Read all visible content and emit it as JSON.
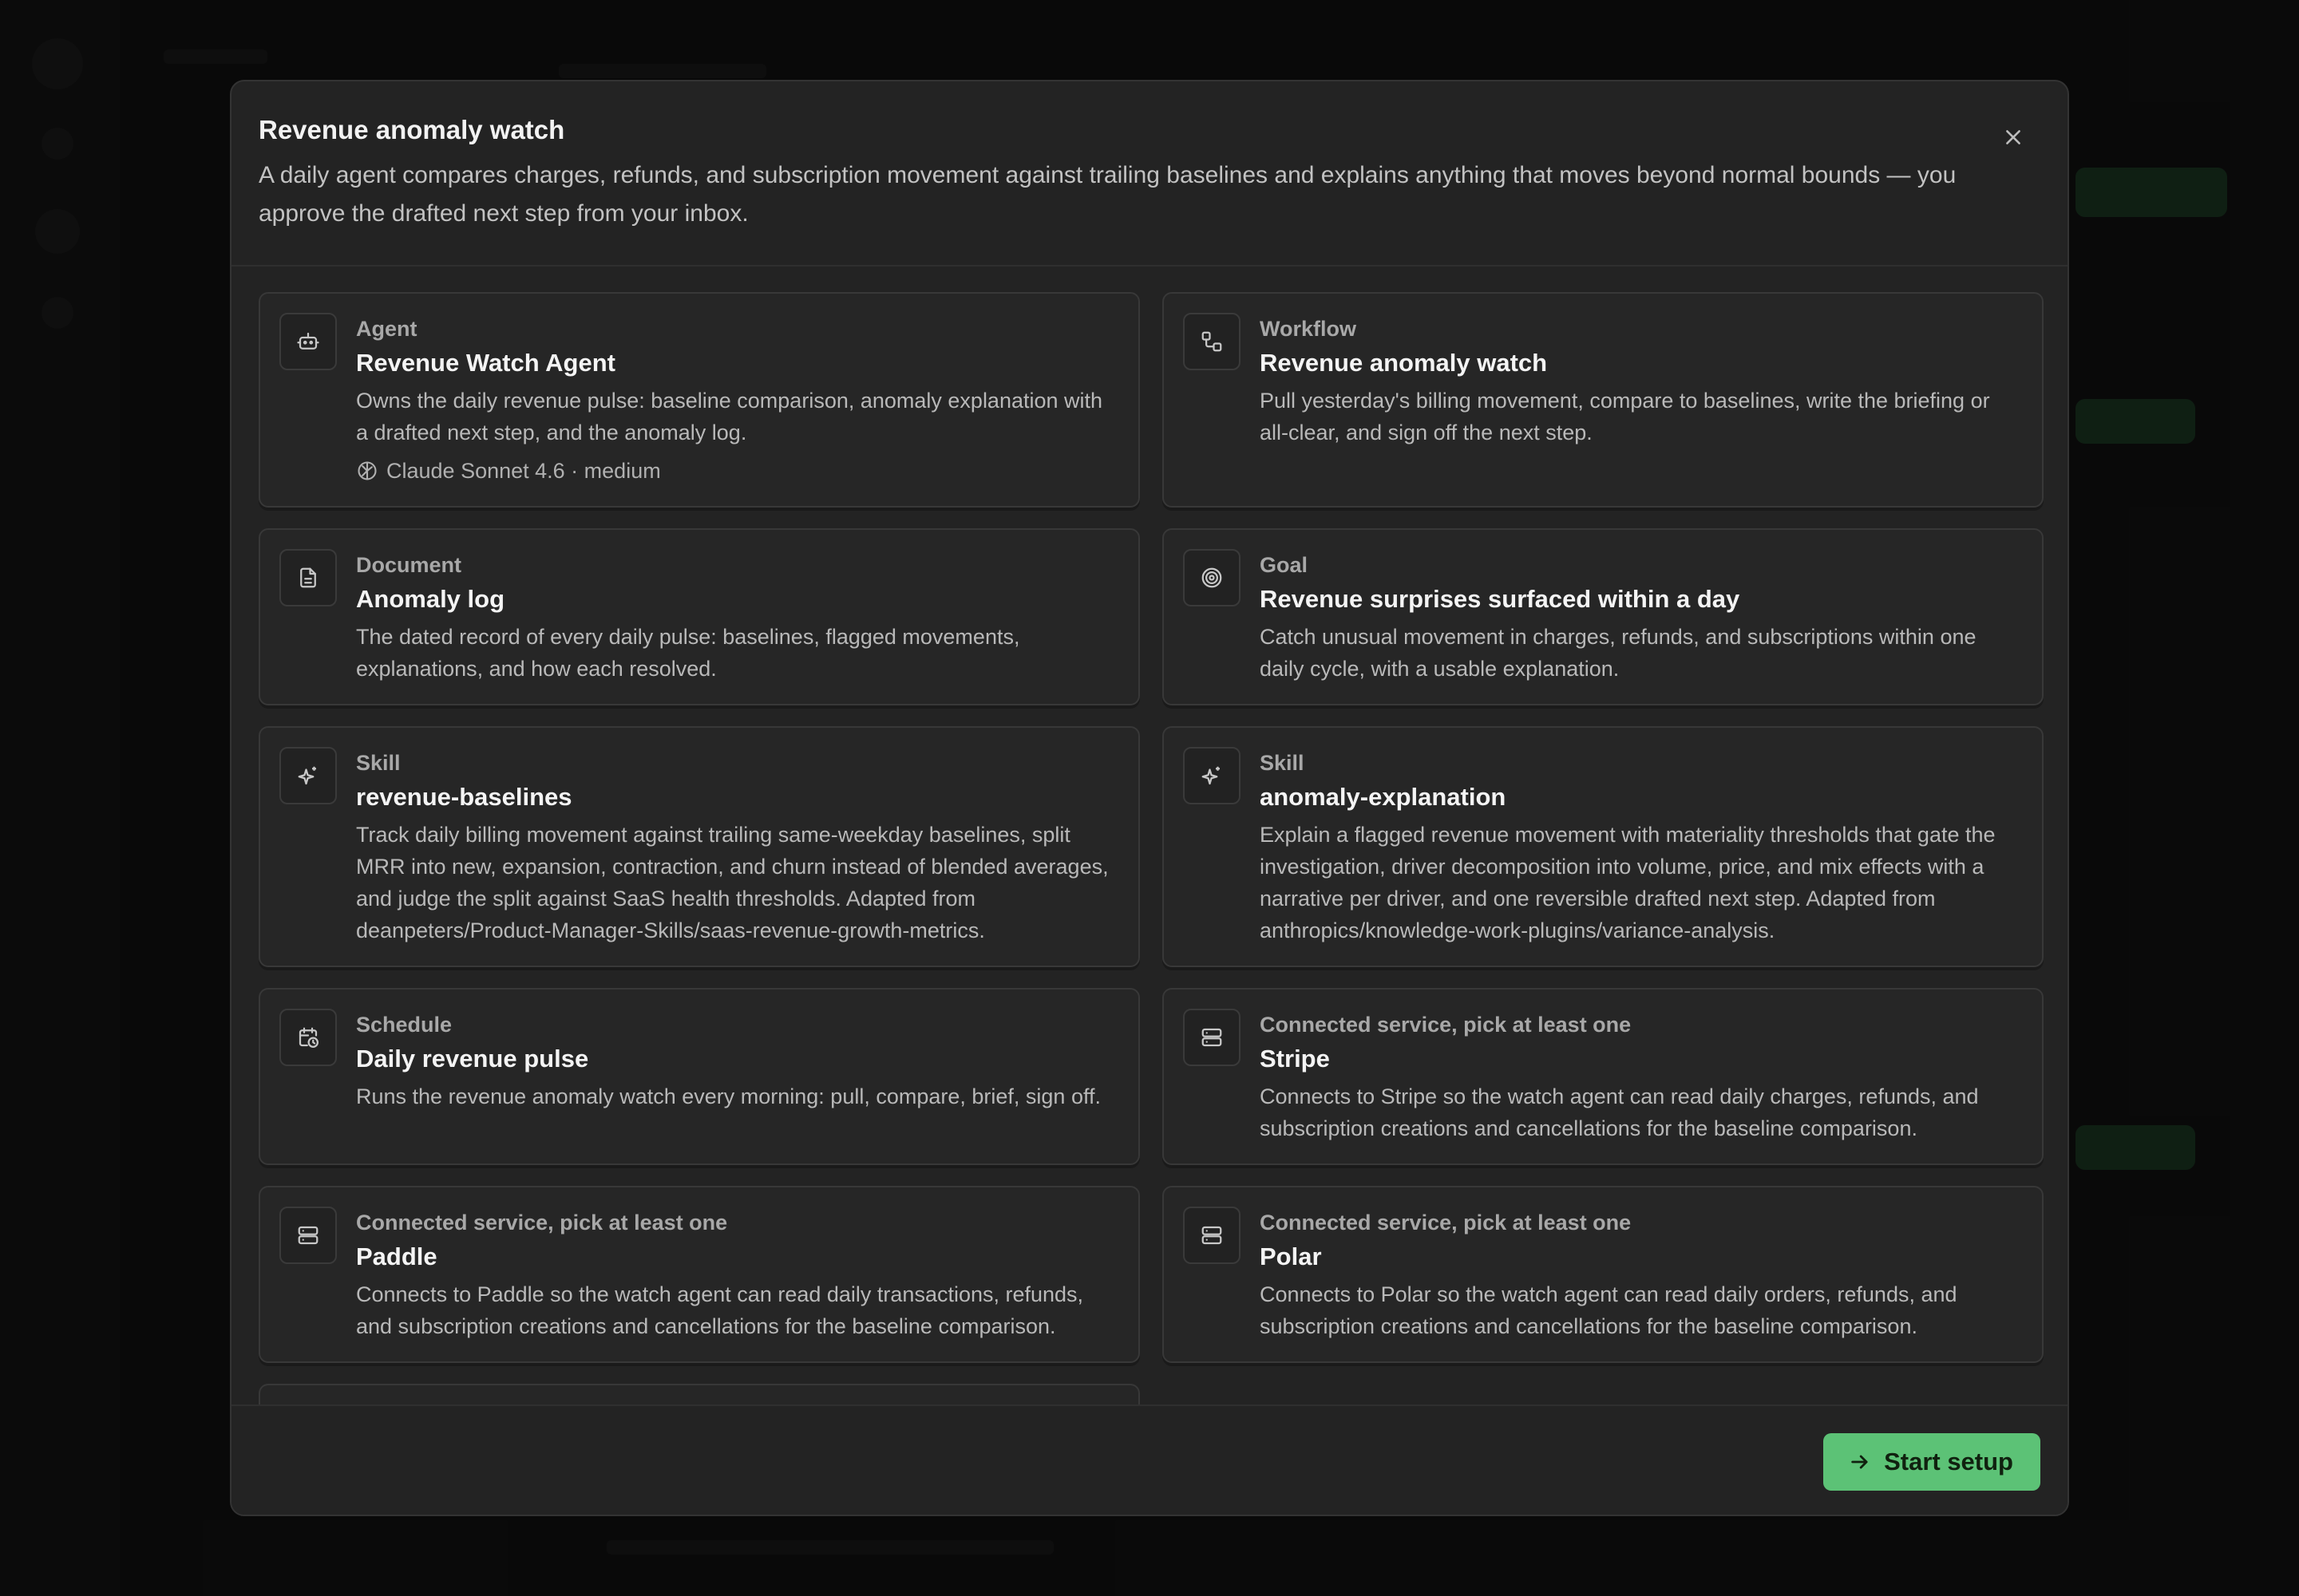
{
  "dialog": {
    "title": "Revenue anomaly watch",
    "description": "A daily agent compares charges, refunds, and subscription movement against trailing baselines and explains anything that moves beyond normal bounds — you approve the drafted next step from your inbox.",
    "close_icon": "close-icon"
  },
  "cards": [
    {
      "type": "Agent",
      "title": "Revenue Watch Agent",
      "description": "Owns the daily revenue pulse: baseline comparison, anomaly explanation with a drafted next step, and the anomaly log.",
      "meta": "Claude Sonnet 4.6 · medium",
      "icon": "robot-icon"
    },
    {
      "type": "Workflow",
      "title": "Revenue anomaly watch",
      "description": "Pull yesterday's billing movement, compare to baselines, write the briefing or all-clear, and sign off the next step.",
      "icon": "workflow-icon"
    },
    {
      "type": "Document",
      "title": "Anomaly log",
      "description": "The dated record of every daily pulse: baselines, flagged movements, explanations, and how each resolved.",
      "icon": "document-icon"
    },
    {
      "type": "Goal",
      "title": "Revenue surprises surfaced within a day",
      "description": "Catch unusual movement in charges, refunds, and subscriptions within one daily cycle, with a usable explanation.",
      "icon": "target-icon"
    },
    {
      "type": "Skill",
      "title": "revenue-baselines",
      "description": "Track daily billing movement against trailing same-weekday baselines, split MRR into new, expansion, contraction, and churn instead of blended averages, and judge the split against SaaS health thresholds. Adapted from deanpeters/Product-Manager-Skills/saas-revenue-growth-metrics.",
      "icon": "sparkle-icon"
    },
    {
      "type": "Skill",
      "title": "anomaly-explanation",
      "description": "Explain a flagged revenue movement with materiality thresholds that gate the investigation, driver decomposition into volume, price, and mix effects with a narrative per driver, and one reversible drafted next step. Adapted from anthropics/knowledge-work-plugins/variance-analysis.",
      "icon": "sparkle-icon"
    },
    {
      "type": "Schedule",
      "title": "Daily revenue pulse",
      "description": "Runs the revenue anomaly watch every morning: pull, compare, brief, sign off.",
      "icon": "calendar-clock-icon"
    },
    {
      "type": "Connected service, pick at least one",
      "title": "Stripe",
      "description": "Connects to Stripe so the watch agent can read daily charges, refunds, and subscription creations and cancellations for the baseline comparison.",
      "icon": "server-icon"
    },
    {
      "type": "Connected service, pick at least one",
      "title": "Paddle",
      "description": "Connects to Paddle so the watch agent can read daily transactions, refunds, and subscription creations and cancellations for the baseline comparison.",
      "icon": "server-icon"
    },
    {
      "type": "Connected service, pick at least one",
      "title": "Polar",
      "description": "Connects to Polar so the watch agent can read daily orders, refunds, and subscription creations and cancellations for the baseline comparison.",
      "icon": "server-icon"
    }
  ],
  "footer": {
    "start_label": "Start setup",
    "start_icon": "arrow-right-icon"
  },
  "colors": {
    "accent": "#5cc276",
    "modal_bg": "#232323",
    "card_bg": "#262626"
  }
}
